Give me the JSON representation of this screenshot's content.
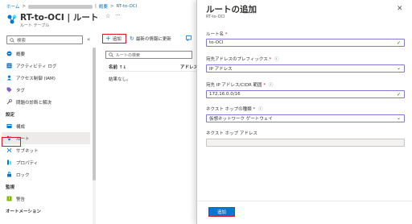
{
  "breadcrumb": {
    "home": "ホーム",
    "sep1": ">",
    "sep2": "|",
    "overview": "概要",
    "sep3": ">",
    "current": "RT-to-OCI"
  },
  "resource": {
    "title": "RT-to-OCI | ルート",
    "subtitle": "ルート テーブル",
    "star_glyph": "☆",
    "more_glyph": "···"
  },
  "nav": {
    "search_placeholder": "検索",
    "collapse_glyph": "«",
    "items": [
      {
        "label": "概要",
        "icon": "overview-icon"
      },
      {
        "label": "アクティビティ ログ",
        "icon": "activity-log-icon"
      },
      {
        "label": "アクセス制御 (IAM)",
        "icon": "iam-icon"
      },
      {
        "label": "タグ",
        "icon": "tag-icon"
      },
      {
        "label": "問題の診断と解決",
        "icon": "diagnose-icon"
      }
    ],
    "settings_header": "設定",
    "settings_items": [
      {
        "label": "構成",
        "icon": "configuration-icon"
      },
      {
        "label": "ルート",
        "icon": "routes-icon",
        "selected": true
      },
      {
        "label": "サブネット",
        "icon": "subnet-icon"
      },
      {
        "label": "プロパティ",
        "icon": "properties-icon"
      },
      {
        "label": "ロック",
        "icon": "lock-icon"
      }
    ],
    "monitoring_header": "監視",
    "monitoring_items": [
      {
        "label": "警告",
        "icon": "alert-icon"
      }
    ],
    "automation_header": "オートメーション"
  },
  "toolbar": {
    "add_label": "追加",
    "add_glyph": "+",
    "refresh_label": "最新の情報に更新",
    "refresh_glyph": "↻"
  },
  "list": {
    "filter_placeholder": "ルートの検索",
    "col_name": "名前 ↑↓",
    "col_address": "アドレス",
    "no_results": "結果なし。"
  },
  "blade": {
    "title": "ルートの追加",
    "subtitle": "RT-to-OCI",
    "close_glyph": "✕",
    "fields": {
      "route_name": {
        "label": "ルート名",
        "value": "to-OCI"
      },
      "prefix_dest": {
        "label": "宛先アドレスのプレフィックス",
        "value": "IP アドレス"
      },
      "dest_range": {
        "label": "宛先 IP アドレス/CIDR 範囲",
        "value": "172.16.0.0/16"
      },
      "next_hop_type": {
        "label": "ネクスト ホップの種類",
        "value": "仮想ネットワーク ゲートウェイ"
      },
      "next_hop_addr": {
        "label": "ネクスト ホップ アドレス",
        "value": ""
      }
    },
    "req_mark": "*",
    "info_glyph": "ⓘ",
    "check_glyph": "✓",
    "chevron_glyph": "⌄",
    "add_button": "追加"
  },
  "colors": {
    "accent": "#0078d4",
    "highlight": "#e81123",
    "valid_border": "#8378de",
    "valid_check": "#107c10"
  }
}
